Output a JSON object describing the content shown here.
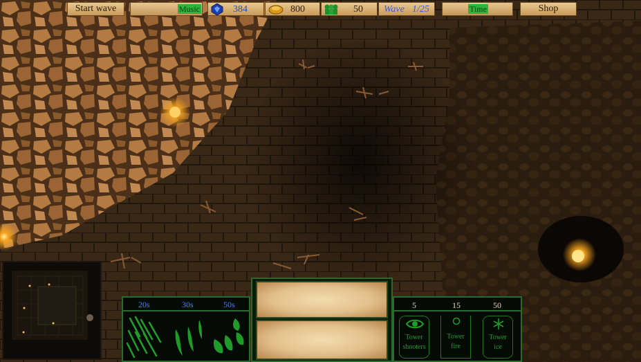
{
  "hud": {
    "start_wave_label": "Start wave",
    "music_label": "Music",
    "music_level": 0.0,
    "crystals_value": "384",
    "gold_value": "800",
    "soldiers_value": "50",
    "wave_label": "Wave",
    "wave_value": "1/25",
    "time_label": "Time",
    "time_progress": 0.0,
    "shop_label": "Shop",
    "icons": [
      "crystal-icon",
      "gold-icon",
      "soldiers-icon"
    ]
  },
  "spell_panel": {
    "timers": [
      "20s",
      "30s",
      "50s"
    ],
    "icons": [
      "arrow-rain-icon",
      "green-fire-icon",
      "poison-flame-icon"
    ]
  },
  "tower_panel": {
    "costs": [
      "5",
      "15",
      "50"
    ],
    "towers": [
      {
        "line1": "Tower",
        "line2": "shooters",
        "icon": "eye-icon"
      },
      {
        "line1": "Tower",
        "line2": "fire",
        "icon": "flame-icon"
      },
      {
        "line1": "Tower",
        "line2": "ice",
        "icon": "snowflake-icon"
      }
    ]
  },
  "colors": {
    "timer_blue": "#4a7fff",
    "panel_green": "#1f9b2a",
    "label_green_bg": "#2fb33a",
    "parchment": "#e2c08b"
  }
}
